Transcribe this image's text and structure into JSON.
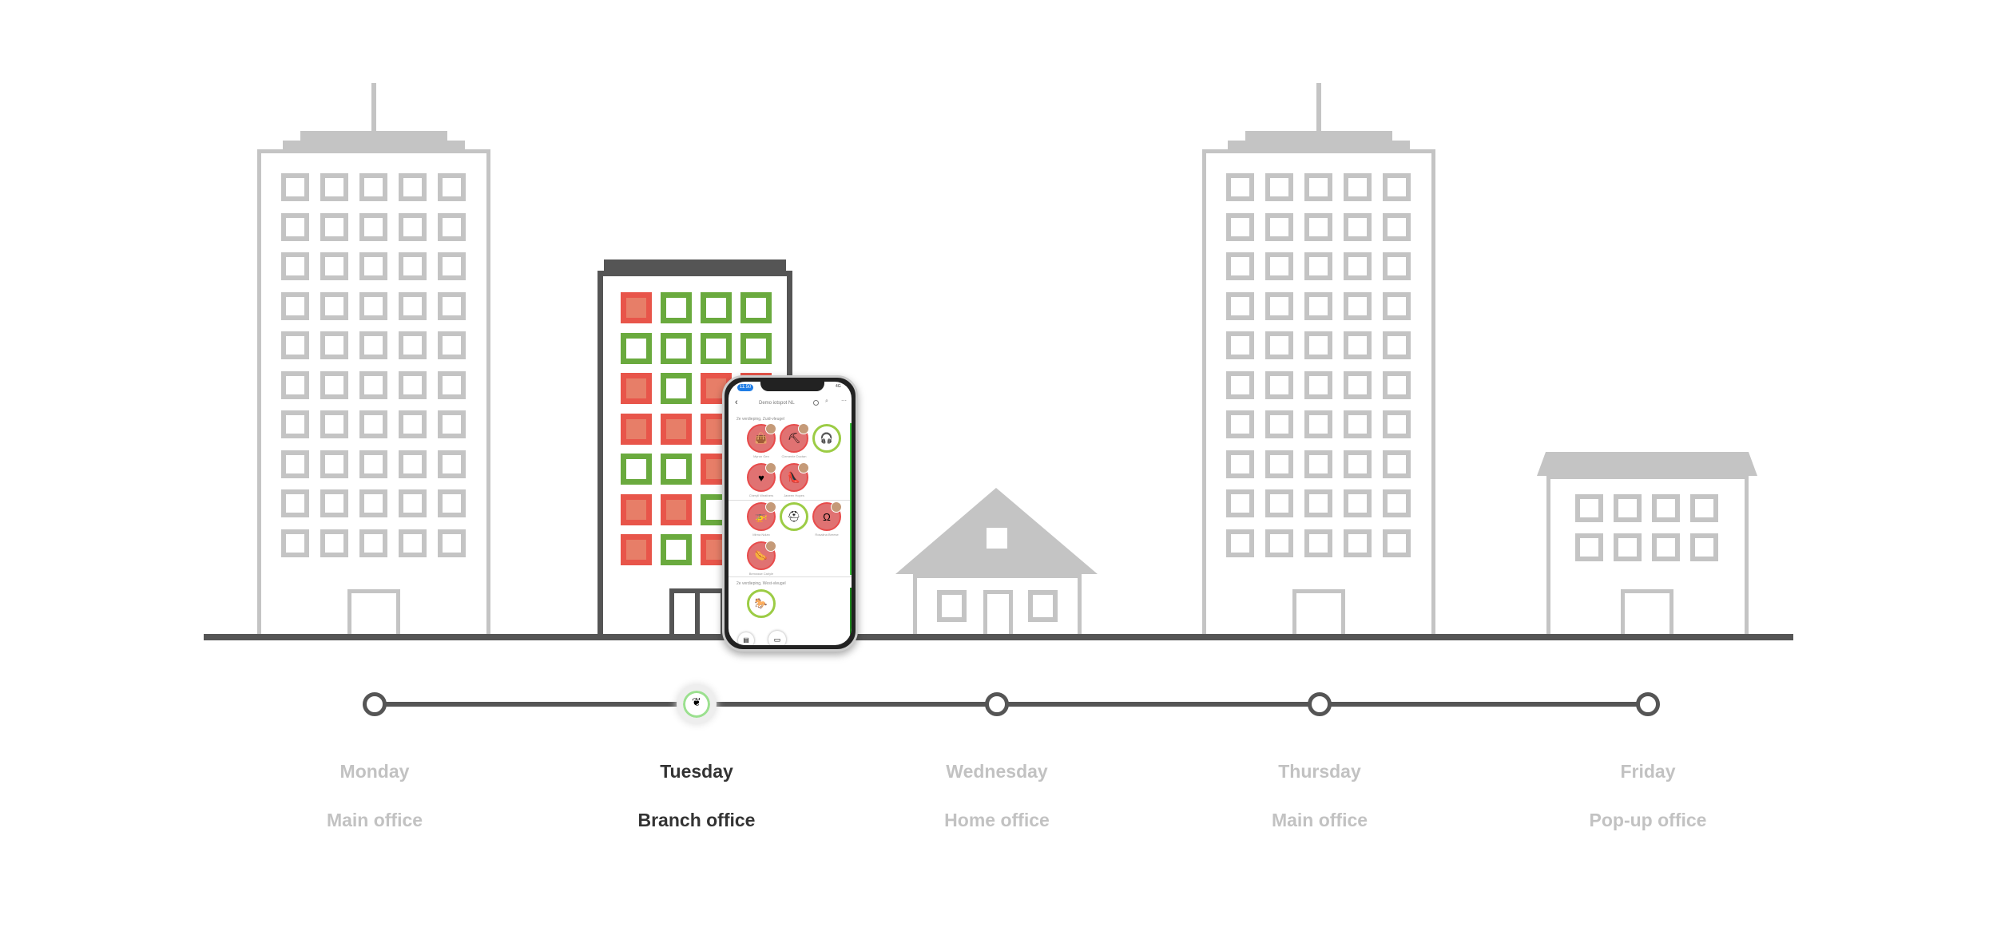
{
  "colors": {
    "occupied": "#e8554a",
    "free": "#6aaa3e",
    "building_gray": "#c4c4c4",
    "building_dark": "#555555",
    "timeline": "#555555",
    "active_text": "#333333",
    "inactive_text": "#c2c2c2"
  },
  "branch_office_windows": [
    [
      "occupied",
      "free",
      "free",
      "free"
    ],
    [
      "free",
      "free",
      "free",
      "free"
    ],
    [
      "occupied",
      "free",
      "occupied",
      "occupied"
    ],
    [
      "occupied",
      "occupied",
      "occupied",
      "occupied"
    ],
    [
      "free",
      "free",
      "occupied",
      "occupied"
    ],
    [
      "occupied",
      "occupied",
      "free",
      "free"
    ],
    [
      "occupied",
      "free",
      "occupied",
      "occupied"
    ]
  ],
  "timeline": {
    "active_index": 1,
    "days": [
      {
        "day": "Monday",
        "place": "Main office"
      },
      {
        "day": "Tuesday",
        "place": "Branch office"
      },
      {
        "day": "Wednesday",
        "place": "Home office"
      },
      {
        "day": "Thursday",
        "place": "Main office"
      },
      {
        "day": "Friday",
        "place": "Pop-up office"
      }
    ]
  },
  "phone": {
    "time": "11:50",
    "network": "4G",
    "title": "Demo iotspot NL",
    "sections": [
      {
        "label": "2e verdieping, Zuid-vleugel"
      },
      {
        "label": "2e verdieping, West-vleugel"
      }
    ],
    "desks": [
      {
        "icon": "bag-icon",
        "glyph": "👜",
        "status": "busy",
        "name": "Myron Gen"
      },
      {
        "icon": "trowel-icon",
        "glyph": "⛏",
        "status": "busy",
        "name": "Clemente Doctan"
      },
      {
        "icon": "headphones-icon",
        "glyph": "🎧",
        "status": "free",
        "name": ""
      },
      {
        "icon": "heart-icon",
        "glyph": "♥",
        "status": "busy",
        "name": "Cheryll Weathers"
      },
      {
        "icon": "shoe-icon",
        "glyph": "👠",
        "status": "busy",
        "name": "Janeen Hopes"
      },
      {
        "icon": "helicopter-icon",
        "glyph": "🚁",
        "status": "busy",
        "name": "Mirna Nolan"
      },
      {
        "icon": "helmet-icon",
        "glyph": "⛑",
        "status": "free",
        "name": ""
      },
      {
        "icon": "horseshoe-icon",
        "glyph": "Ω",
        "status": "busy",
        "name": "Rosalina Breese"
      },
      {
        "icon": "hotdog-icon",
        "glyph": "🌭",
        "status": "busy",
        "name": "Bernasse Carlyle"
      },
      {
        "icon": "horse-icon",
        "glyph": "🐎",
        "status": "free",
        "name": ""
      }
    ]
  }
}
